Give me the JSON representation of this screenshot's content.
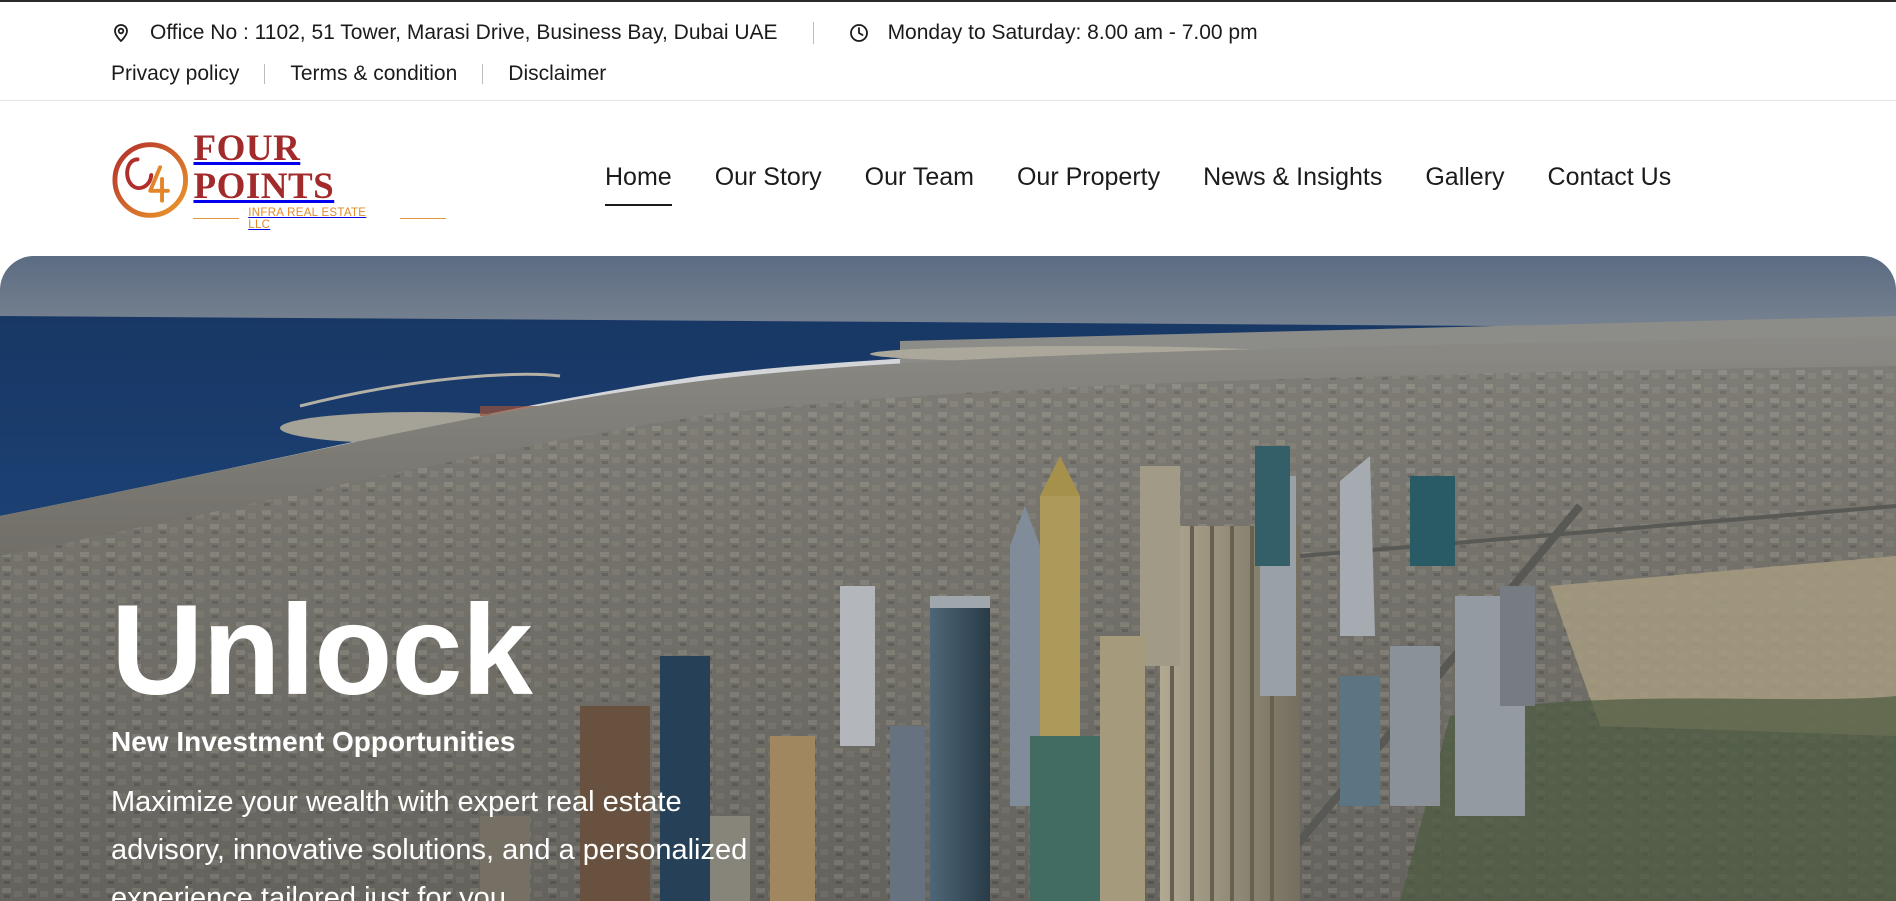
{
  "topbar": {
    "address": "Office No : 1102, 51 Tower, Marasi Drive, Business Bay, Dubai UAE",
    "hours": "Monday to Saturday: 8.00 am - 7.00 pm",
    "address_icon": "location-pin-icon",
    "hours_icon": "clock-icon",
    "links": [
      {
        "label": "Privacy policy"
      },
      {
        "label": "Terms & condition"
      },
      {
        "label": "Disclaimer"
      }
    ]
  },
  "brand": {
    "name": "FOUR POINTS",
    "subtitle": "INFRA REAL ESTATE LLC",
    "primary_color": "#a32a2b",
    "accent_color": "#e08a2a"
  },
  "nav": {
    "items": [
      {
        "label": "Home",
        "active": true
      },
      {
        "label": "Our Story"
      },
      {
        "label": "Our Team"
      },
      {
        "label": "Our Property"
      },
      {
        "label": "News & Insights"
      },
      {
        "label": "Gallery"
      },
      {
        "label": "Contact Us"
      }
    ]
  },
  "hero": {
    "title": "Unlock",
    "subtitle": "New Investment Opportunities",
    "description": "Maximize your wealth with expert real estate advisory, innovative solutions, and a personalized experience tailored just for you."
  }
}
